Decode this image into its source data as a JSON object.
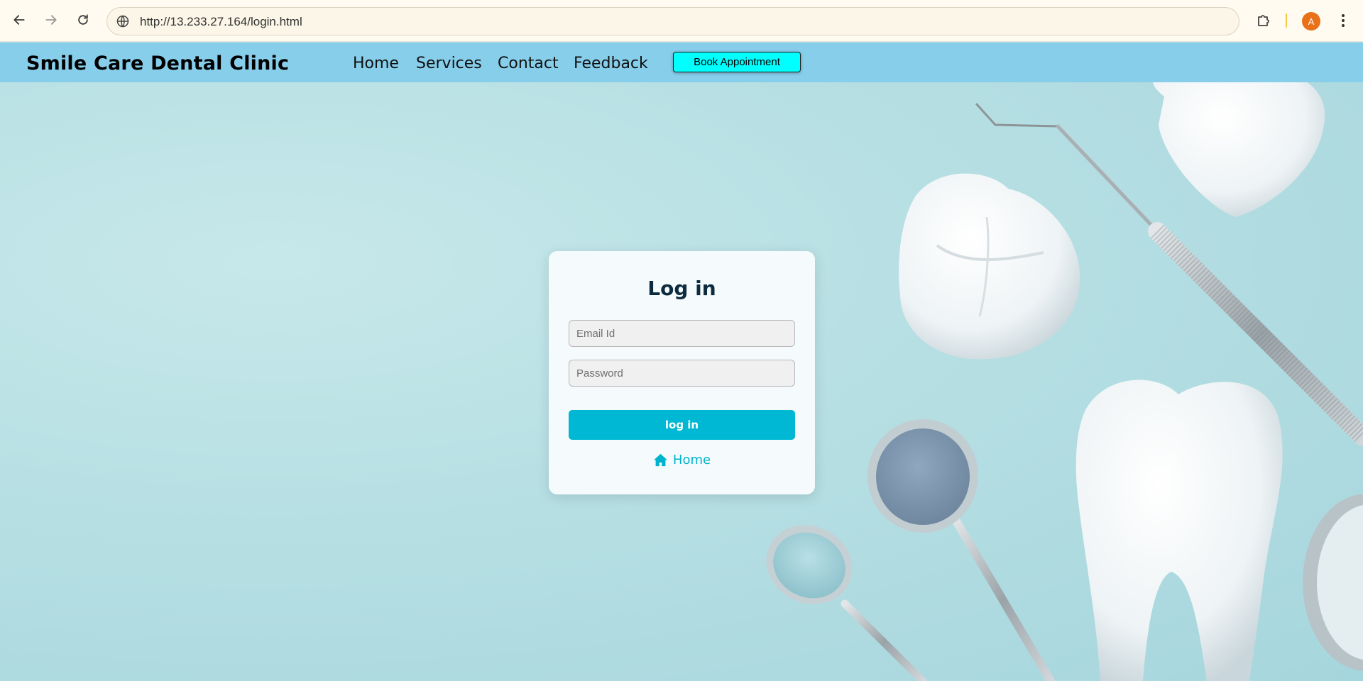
{
  "browser": {
    "url": "http://13.233.27.164/login.html",
    "avatar_letter": "A",
    "icons": [
      "back-arrow-icon",
      "forward-arrow-icon",
      "reload-icon",
      "site-info-icon",
      "extensions-icon",
      "kebab-menu-icon"
    ]
  },
  "header": {
    "brand": "Smile Care Dental Clinic",
    "nav": {
      "home": "Home",
      "services": "Services",
      "contact": "Contact",
      "feedback": "Feedback"
    },
    "book_button": "Book Appointment"
  },
  "login": {
    "title": "Log in",
    "email_placeholder": "Email Id",
    "password_placeholder": "Password",
    "submit_label": "log in",
    "home_link": "Home"
  },
  "colors": {
    "header_bg": "#87ceeb",
    "book_button_bg": "#00ffff",
    "accent": "#00b8d4",
    "title_color": "#0d2b3e"
  }
}
